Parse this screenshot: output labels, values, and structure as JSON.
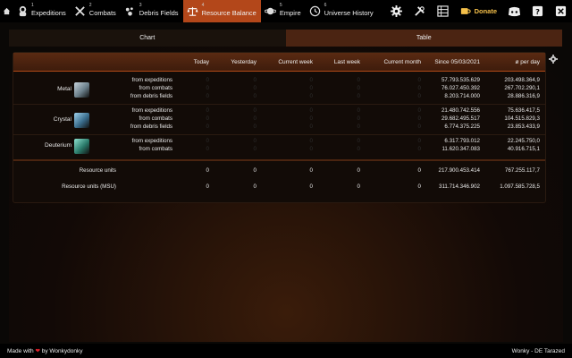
{
  "nav": {
    "items": [
      {
        "num": "1",
        "label": "Expeditions",
        "icon": "astronaut-icon"
      },
      {
        "num": "2",
        "label": "Combats",
        "icon": "crossed-swords-icon"
      },
      {
        "num": "3",
        "label": "Debris Fields",
        "icon": "debris-icon"
      },
      {
        "num": "4",
        "label": "Resource Balance",
        "icon": "scales-icon"
      },
      {
        "num": "5",
        "label": "Empire",
        "icon": "planet-icon"
      },
      {
        "num": "6",
        "label": "Universe History",
        "icon": "history-icon"
      }
    ],
    "active_index": 3,
    "donate_label": "Donate",
    "right_icons": [
      "gear-icon",
      "tools-icon",
      "spreadsheet-icon",
      "coffee-icon",
      "discord-icon",
      "help-icon",
      "close-icon"
    ]
  },
  "tabs": {
    "chart": "Chart",
    "table": "Table"
  },
  "table": {
    "headers": [
      "Today",
      "Yesterday",
      "Current week",
      "Last week",
      "Current month",
      "Since 05/03/2021",
      "ø per day"
    ],
    "resources": [
      {
        "name": "Metal",
        "rows": [
          {
            "label": "from expeditions",
            "values": [
              "0",
              "0",
              "0",
              "0",
              "0",
              "57.793.535.629",
              "203.498.364,9"
            ]
          },
          {
            "label": "from combats",
            "values": [
              "0",
              "0",
              "0",
              "0",
              "0",
              "76.027.450.392",
              "267.702.290,1"
            ]
          },
          {
            "label": "from debris fields",
            "values": [
              "0",
              "0",
              "0",
              "0",
              "0",
              "8.203.714.000",
              "28.886.316,9"
            ]
          }
        ]
      },
      {
        "name": "Crystal",
        "rows": [
          {
            "label": "from expeditions",
            "values": [
              "0",
              "0",
              "0",
              "0",
              "0",
              "21.480.742.556",
              "75.636.417,5"
            ]
          },
          {
            "label": "from combats",
            "values": [
              "0",
              "0",
              "0",
              "0",
              "0",
              "29.682.495.517",
              "104.515.829,3"
            ]
          },
          {
            "label": "from debris fields",
            "values": [
              "0",
              "0",
              "0",
              "0",
              "0",
              "6.774.375.225",
              "23.853.433,9"
            ]
          }
        ]
      },
      {
        "name": "Deuterium",
        "rows": [
          {
            "label": "from expeditions",
            "values": [
              "0",
              "0",
              "0",
              "0",
              "0",
              "6.317.793.012",
              "22.245.750,0"
            ]
          },
          {
            "label": "from combats",
            "values": [
              "0",
              "0",
              "0",
              "0",
              "0",
              "11.620.347.083",
              "40.916.715,1"
            ]
          }
        ]
      }
    ],
    "totals": [
      {
        "label": "Resource units",
        "values": [
          "0",
          "0",
          "0",
          "0",
          "0",
          "217.900.453.414",
          "767.255.117,7"
        ]
      },
      {
        "label": "Resource units (MSU)",
        "values": [
          "0",
          "0",
          "0",
          "0",
          "0",
          "311.714.346.902",
          "1.097.585.728,5"
        ]
      }
    ]
  },
  "footer": {
    "made_with": "Made with",
    "by": "by Wonkydonky",
    "right": "Wonky - DE Tarazed"
  },
  "colors": {
    "accent": "#b3471a",
    "donate": "#f5c04a",
    "heart": "#e0202a"
  }
}
